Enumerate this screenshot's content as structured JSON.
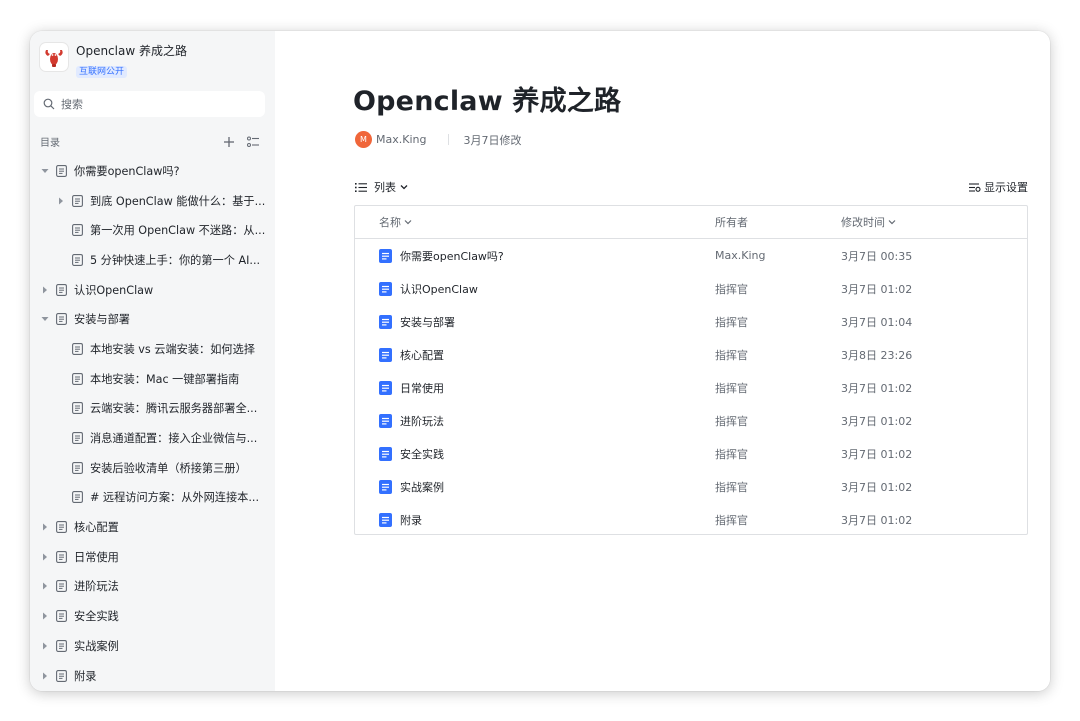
{
  "sidebar": {
    "brand": {
      "title": "Openclaw 养成之路",
      "badge": "互联网公开"
    },
    "search": {
      "placeholder": "搜索"
    },
    "toc_title": "目录",
    "tree": [
      {
        "level": 0,
        "expanded": true,
        "has_children": true,
        "label": "你需要openClaw吗?"
      },
      {
        "level": 1,
        "expanded": false,
        "has_children": true,
        "label": "到底 OpenClaw 能做什么：基于..."
      },
      {
        "level": 1,
        "expanded": false,
        "has_children": false,
        "label": "第一次用 OpenClaw 不迷路：从..."
      },
      {
        "level": 1,
        "expanded": false,
        "has_children": false,
        "label": "5 分钟快速上手：你的第一个 AI..."
      },
      {
        "level": 0,
        "expanded": false,
        "has_children": true,
        "label": "认识OpenClaw"
      },
      {
        "level": 0,
        "expanded": true,
        "has_children": true,
        "label": "安装与部署"
      },
      {
        "level": 1,
        "expanded": false,
        "has_children": false,
        "label": "本地安装 vs 云端安装：如何选择"
      },
      {
        "level": 1,
        "expanded": false,
        "has_children": false,
        "label": "本地安装：Mac 一键部署指南"
      },
      {
        "level": 1,
        "expanded": false,
        "has_children": false,
        "label": "云端安装：腾讯云服务器部署全..."
      },
      {
        "level": 1,
        "expanded": false,
        "has_children": false,
        "label": "消息通道配置：接入企业微信与..."
      },
      {
        "level": 1,
        "expanded": false,
        "has_children": false,
        "label": "安装后验收清单（桥接第三册）"
      },
      {
        "level": 1,
        "expanded": false,
        "has_children": false,
        "label": "# 远程访问方案：从外网连接本..."
      },
      {
        "level": 0,
        "expanded": false,
        "has_children": true,
        "label": "核心配置"
      },
      {
        "level": 0,
        "expanded": false,
        "has_children": true,
        "label": "日常使用"
      },
      {
        "level": 0,
        "expanded": false,
        "has_children": true,
        "label": "进阶玩法"
      },
      {
        "level": 0,
        "expanded": false,
        "has_children": true,
        "label": "安全实践"
      },
      {
        "level": 0,
        "expanded": false,
        "has_children": true,
        "label": "实战案例"
      },
      {
        "level": 0,
        "expanded": false,
        "has_children": true,
        "label": "附录"
      }
    ]
  },
  "main": {
    "title": "Openclaw 养成之路",
    "author": {
      "initial": "M",
      "name": "Max.King"
    },
    "modified": "3月7日修改",
    "view_label": "列表",
    "display_settings": "显示设置",
    "table": {
      "headers": {
        "name": "名称",
        "owner": "所有者",
        "time": "修改时间"
      },
      "rows": [
        {
          "name": "你需要openClaw吗?",
          "owner": "Max.King",
          "time": "3月7日 00:35"
        },
        {
          "name": "认识OpenClaw",
          "owner": "指挥官",
          "time": "3月7日 01:02"
        },
        {
          "name": "安装与部署",
          "owner": "指挥官",
          "time": "3月7日 01:04"
        },
        {
          "name": "核心配置",
          "owner": "指挥官",
          "time": "3月8日 23:26"
        },
        {
          "name": "日常使用",
          "owner": "指挥官",
          "time": "3月7日 01:02"
        },
        {
          "name": "进阶玩法",
          "owner": "指挥官",
          "time": "3月7日 01:02"
        },
        {
          "name": "安全实践",
          "owner": "指挥官",
          "time": "3月7日 01:02"
        },
        {
          "name": "实战案例",
          "owner": "指挥官",
          "time": "3月7日 01:02"
        },
        {
          "name": "附录",
          "owner": "指挥官",
          "time": "3月7日 01:02"
        }
      ]
    }
  },
  "colors": {
    "accent": "#3370ff",
    "doc_icon": "#3370ff",
    "avatar": "#f0663a",
    "sidebar_bg": "#f5f6f7"
  }
}
